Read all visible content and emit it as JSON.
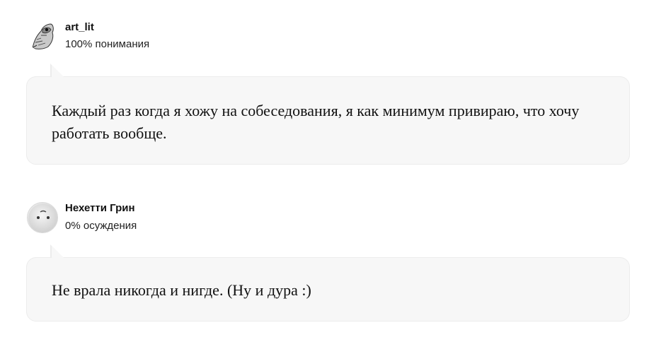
{
  "comments": [
    {
      "username": "art_lit",
      "meta": "100% понимания",
      "avatar_icon": "owl-sketch-avatar",
      "message": "Каждый раз когда я хожу на собеседования, я как минимум привираю, что хочу работать вообще."
    },
    {
      "username": "Нехетти Грин",
      "meta": "0% осуждения",
      "avatar_icon": "default-face-avatar",
      "message": "Не врала никогда и нигде. (Ну и дура :)"
    }
  ],
  "colors": {
    "bubble_bg": "#f7f7f7",
    "bubble_border": "#ececec",
    "text": "#111111"
  }
}
